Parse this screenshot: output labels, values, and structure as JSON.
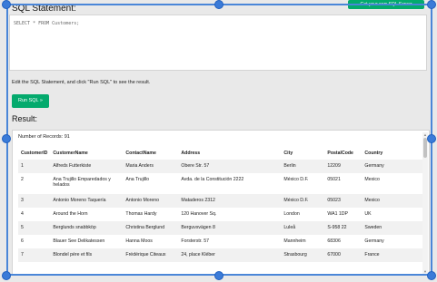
{
  "editor_section": {
    "title": "SQL Statement:",
    "get_button_label": "Get your own SQL Server",
    "sql_text": "SELECT * FROM Customers;"
  },
  "hint": "Edit the SQL Statement, and click \"Run SQL\" to see the result.",
  "run_button_label": "Run SQL »",
  "result": {
    "title": "Result:",
    "record_count": "Number of Records: 91",
    "columns": [
      "CustomerID",
      "CustomerName",
      "ContactName",
      "Address",
      "City",
      "PostalCode",
      "Country"
    ],
    "rows": [
      [
        "1",
        "Alfreds Futterkiste",
        "Maria Anders",
        "Obere Str. 57",
        "Berlin",
        "12209",
        "Germany"
      ],
      [
        "2",
        "Ana Trujillo Emparedados y helados",
        "Ana Trujillo",
        "Avda. de la Constitución 2222",
        "México D.F.",
        "05021",
        "Mexico"
      ],
      [
        "3",
        "Antonio Moreno Taquería",
        "Antonio Moreno",
        "Mataderos 2312",
        "México D.F.",
        "05023",
        "Mexico"
      ],
      [
        "4",
        "Around the Horn",
        "Thomas Hardy",
        "120 Hanover Sq.",
        "London",
        "WA1 1DP",
        "UK"
      ],
      [
        "5",
        "Berglunds snabbköp",
        "Christina Berglund",
        "Berguvsvägen 8",
        "Luleå",
        "S-958 22",
        "Sweden"
      ],
      [
        "6",
        "Blauer See Delikatessen",
        "Hanna Moos",
        "Forsterstr. 57",
        "Mannheim",
        "68306",
        "Germany"
      ],
      [
        "7",
        "Blondel père et fils",
        "Frédérique Citeaux",
        "24, place Kléber",
        "Strasbourg",
        "67000",
        "France"
      ]
    ]
  }
}
